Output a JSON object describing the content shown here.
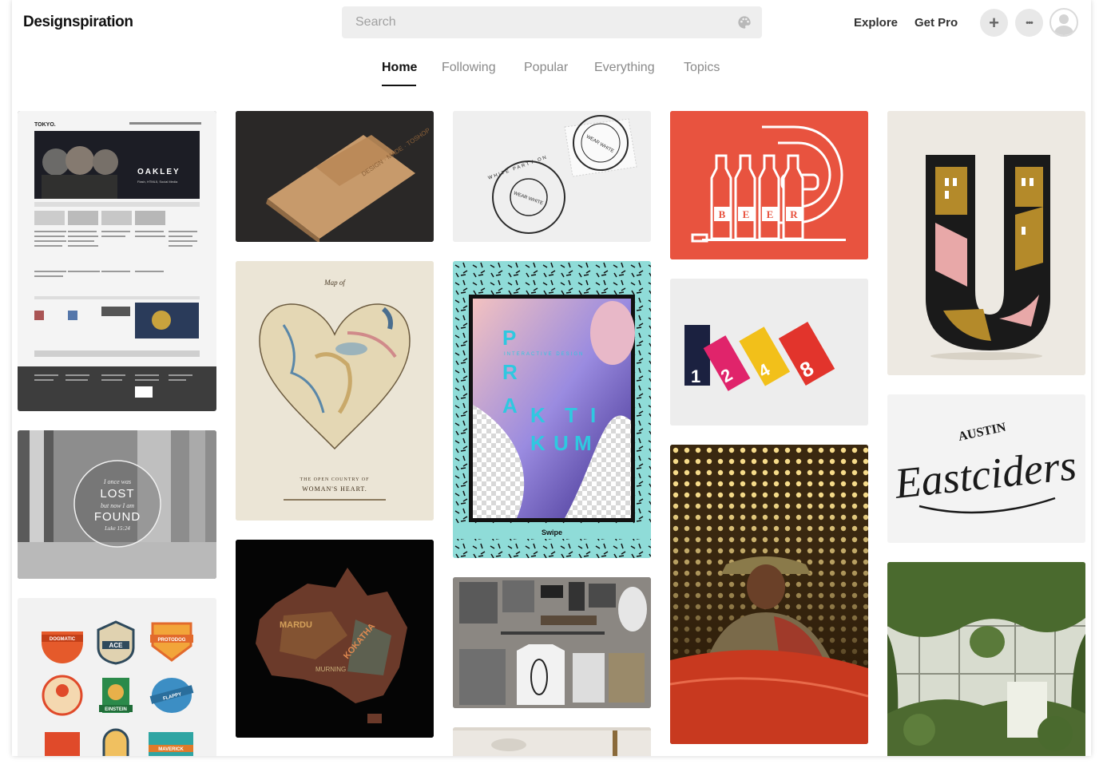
{
  "header": {
    "logo": "Designspiration",
    "search_placeholder": "Search",
    "explore": "Explore",
    "get_pro": "Get Pro",
    "add_symbol": "+",
    "more_symbol": "•••"
  },
  "tabs": [
    {
      "label": "Home",
      "active": true
    },
    {
      "label": "Following",
      "active": false
    },
    {
      "label": "Popular",
      "active": false
    },
    {
      "label": "Everything",
      "active": false
    },
    {
      "label": "Topics",
      "active": false
    }
  ],
  "tiles": {
    "oakley": {
      "brand": "TOKYO.",
      "headline": "OAKLEY",
      "sub": "Flash, HTML5, Social Media"
    },
    "lost": {
      "line1": "I once was",
      "word1": "LOST",
      "line2": "but now I am",
      "word2": "FOUND",
      "ref": "Luke 15:24"
    },
    "badges": {
      "items": [
        "DOGMATIC",
        "ACE",
        "PROTODOG",
        "",
        "EINSTEIN",
        "FLAPPY",
        "",
        "",
        "MAVERICK"
      ]
    },
    "packaging": {
      "text": "DESIGN · MADE · TOSHOP"
    },
    "heart_map": {
      "title": "Map of",
      "caption": "THE OPEN COUNTRY OF",
      "caption2": "WOMAN'S HEART."
    },
    "australia": {
      "words": [
        "MARDU",
        "KOKATHA",
        "MURNING"
      ]
    },
    "stamps": {
      "ring_text": "WHITE PARTY ON",
      "center": "WEAR WHITE"
    },
    "praktikum": {
      "letters": [
        "P",
        "R",
        "A",
        "K",
        "T",
        "I",
        "K",
        "U",
        "M"
      ],
      "sub": "INTERACTIVE DESIGN",
      "footer": "Swipe"
    },
    "beer": {
      "letters": [
        "B",
        "E",
        "E",
        "R"
      ]
    },
    "cards": {
      "numbers": [
        "1",
        "2",
        "4",
        "8"
      ]
    },
    "cider": {
      "top": "AUSTIN",
      "script": "Eastciders"
    }
  }
}
